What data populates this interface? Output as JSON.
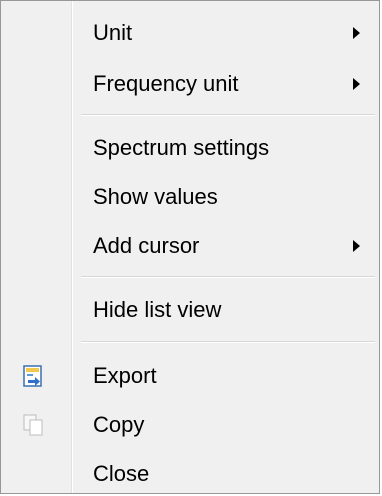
{
  "menu": {
    "items": [
      {
        "label": "Unit",
        "submenu": true,
        "icon": null
      },
      {
        "label": "Frequency unit",
        "submenu": true,
        "icon": null
      },
      {
        "label": "Spectrum settings",
        "submenu": false,
        "icon": null
      },
      {
        "label": "Show values",
        "submenu": false,
        "icon": null
      },
      {
        "label": "Add cursor",
        "submenu": true,
        "icon": null
      },
      {
        "label": "Hide list view",
        "submenu": false,
        "icon": null
      },
      {
        "label": "Export",
        "submenu": false,
        "icon": "export-icon"
      },
      {
        "label": "Copy",
        "submenu": false,
        "icon": "copy-icon"
      },
      {
        "label": "Close",
        "submenu": false,
        "icon": null
      }
    ]
  },
  "colors": {
    "background": "#f0f0f0",
    "border": "#979797",
    "separator": "#d7d7d7"
  }
}
